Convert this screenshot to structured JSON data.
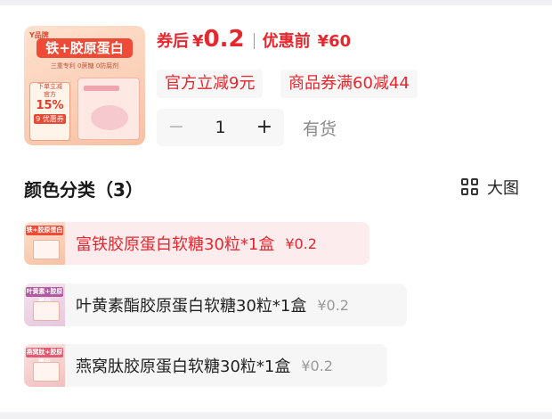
{
  "product": {
    "thumbnail": {
      "brand": "Y品牌",
      "title": "铁+胶原蛋白",
      "subtitle": "三重专利 0蔗糖 0防腐剂",
      "deal_line1": "下单立减",
      "deal_line2": "官方",
      "deal_pct": "15%",
      "deal_coupon": "9 优惠券"
    },
    "price_label": "券后",
    "price_symbol": "¥",
    "price_value": "0.2",
    "original_label": "优惠前",
    "original_value": "¥60"
  },
  "coupons": [
    "官方立减9元",
    "商品券满60减44"
  ],
  "quantity": {
    "minus": "−",
    "value": "1",
    "plus": "+",
    "stock": "有货"
  },
  "variants": {
    "title": "颜色分类（3）",
    "view_label": "大图",
    "items": [
      {
        "name": "富铁胶原蛋白软糖30粒*1盒",
        "price": "¥0.2",
        "mini_label": "铁+胶原蛋白",
        "selected": true
      },
      {
        "name": "叶黄素酯胶原蛋白软糖30粒*1盒",
        "price": "¥0.2",
        "mini_label": "叶黄素+胶原蛋白",
        "selected": false
      },
      {
        "name": "燕窝肽胶原蛋白软糖30粒*1盒",
        "price": "¥0.2",
        "mini_label": "燕窝肽+胶原蛋白",
        "selected": false
      }
    ]
  },
  "colors": {
    "accent": "#e8262e",
    "selected_bg": "#fdeced",
    "chip_bg": "#f6f6f6",
    "muted": "#999999"
  },
  "icons": {
    "view_toggle": "grid-view-icon"
  }
}
